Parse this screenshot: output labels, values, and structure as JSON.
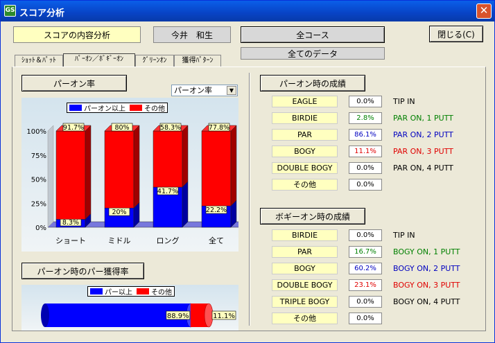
{
  "window": {
    "title": "スコア分析",
    "close_label": "✕"
  },
  "header": {
    "analysis_label": "スコアの内容分析",
    "player_name": "今井　和生",
    "course_select": "全コース",
    "data_select": "全てのデータ",
    "close_button": "閉じる(C)"
  },
  "tabs": [
    {
      "label": "ｼｮｯﾄ＆ﾊﾟｯﾄ",
      "active": false
    },
    {
      "label": "ﾊﾟｰｵﾝ／ﾎﾞｷﾞｰｵﾝ",
      "active": true
    },
    {
      "label": "ｸﾞﾘｰﾝｵﾝ",
      "active": false
    },
    {
      "label": "獲得ﾊﾟﾀｰﾝ",
      "active": false
    }
  ],
  "left": {
    "par_on_rate_button": "パーオン率",
    "dropdown_value": "パーオン率",
    "par_rate_button": "パーオン時のパー獲得率"
  },
  "colors": {
    "blue": "#0000ff",
    "red": "#ff0000",
    "green": "#008000",
    "label_bg": "#ffffc0"
  },
  "chart_data": [
    {
      "type": "bar",
      "stacked": true,
      "categories": [
        "ショート",
        "ミドル",
        "ロング",
        "全て"
      ],
      "series": [
        {
          "name": "パーオン以上",
          "color": "#0000ff",
          "values": [
            8.3,
            20,
            41.7,
            22.2
          ],
          "labels": [
            "8.3%",
            "20%",
            "41.7%",
            "22.2%"
          ]
        },
        {
          "name": "その他",
          "color": "#ff0000",
          "values": [
            91.7,
            80,
            58.3,
            77.8
          ],
          "labels": [
            "91.7%",
            "80%",
            "58.3%",
            "77.8%"
          ]
        }
      ],
      "y_ticks": [
        "100%",
        "75%",
        "50%",
        "25%",
        "0%"
      ],
      "ylim": [
        0,
        100
      ],
      "legend_position": "top"
    },
    {
      "type": "bar",
      "orientation": "horizontal",
      "stacked": true,
      "series": [
        {
          "name": "パー以上",
          "color": "#0000ff",
          "value": 88.9,
          "label": "88.9%"
        },
        {
          "name": "その他",
          "color": "#ff0000",
          "value": 11.1,
          "label": "11.1%"
        }
      ],
      "legend_position": "top"
    }
  ],
  "right": {
    "par_on_button": "パーオン時の成績",
    "par_on_rows": [
      {
        "label": "EAGLE",
        "value": "0.0%",
        "desc": "TIP IN",
        "color": "#000000"
      },
      {
        "label": "BIRDIE",
        "value": "2.8%",
        "desc": "PAR ON, 1 PUTT",
        "color": "#008000"
      },
      {
        "label": "PAR",
        "value": "86.1%",
        "desc": "PAR ON, 2 PUTT",
        "color": "#0000c0"
      },
      {
        "label": "BOGY",
        "value": "11.1%",
        "desc": "PAR ON, 3 PUTT",
        "color": "#e00000"
      },
      {
        "label": "DOUBLE BOGY",
        "value": "0.0%",
        "desc": "PAR ON, 4 PUTT",
        "color": "#000000"
      },
      {
        "label": "その他",
        "value": "0.0%",
        "desc": "",
        "color": "#000000"
      }
    ],
    "bogey_on_button": "ボギーオン時の成績",
    "bogey_on_rows": [
      {
        "label": "BIRDIE",
        "value": "0.0%",
        "desc": "TIP IN",
        "color": "#000000"
      },
      {
        "label": "PAR",
        "value": "16.7%",
        "desc": "BOGY ON, 1 PUTT",
        "color": "#008000"
      },
      {
        "label": "BOGY",
        "value": "60.2%",
        "desc": "BOGY ON, 2 PUTT",
        "color": "#0000c0"
      },
      {
        "label": "DOUBLE BOGY",
        "value": "23.1%",
        "desc": "BOGY ON, 3 PUTT",
        "color": "#e00000"
      },
      {
        "label": "TRIPLE BOGY",
        "value": "0.0%",
        "desc": "BOGY ON, 4 PUTT",
        "color": "#000000"
      },
      {
        "label": "その他",
        "value": "0.0%",
        "desc": "",
        "color": "#000000"
      }
    ]
  }
}
